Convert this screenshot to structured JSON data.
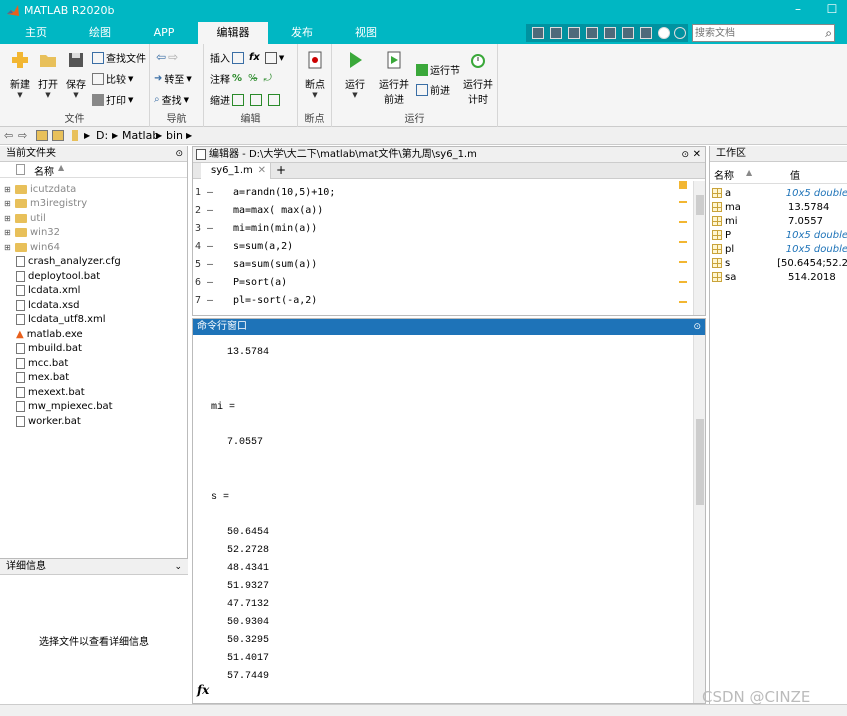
{
  "window": {
    "title": "MATLAB R2020b"
  },
  "tabs": [
    "主页",
    "绘图",
    "APP",
    "编辑器",
    "发布",
    "视图"
  ],
  "active_tab": "编辑器",
  "search": {
    "placeholder": "搜索文档"
  },
  "ribbon": {
    "file": {
      "new": "新建",
      "open": "打开",
      "save": "保存",
      "find_files": "查找文件",
      "compare": "比较",
      "print": "打印",
      "group": "文件"
    },
    "navigate": {
      "goto": "转至",
      "find": "查找",
      "group": "导航"
    },
    "edit": {
      "insert": "插入",
      "comment": "注释",
      "indent": "缩进",
      "group": "编辑"
    },
    "breakpoints": {
      "label": "断点",
      "group": "断点"
    },
    "run": {
      "run": "运行",
      "run_advance": "运行并",
      "run_advance2": "前进",
      "run_section": "运行节",
      "advance": "前进",
      "run_time": "运行并",
      "run_time2": "计时",
      "group": "运行"
    }
  },
  "address": {
    "drive": "D:",
    "folder1": "Matlab",
    "folder2": "bin"
  },
  "current_folder": {
    "title": "当前文件夹",
    "col_name": "名称",
    "folders": [
      "icutzdata",
      "m3iregistry",
      "util",
      "win32",
      "win64"
    ],
    "files": [
      "crash_analyzer.cfg",
      "deploytool.bat",
      "lcdata.xml",
      "lcdata.xsd",
      "lcdata_utf8.xml",
      "matlab.exe",
      "mbuild.bat",
      "mcc.bat",
      "mex.bat",
      "mexext.bat",
      "mw_mpiexec.bat",
      "worker.bat"
    ]
  },
  "details": {
    "title": "详细信息",
    "message": "选择文件以查看详细信息"
  },
  "editor": {
    "title": "编辑器 - D:\\大学\\大二下\\matlab\\mat文件\\第九周\\sy6_1.m",
    "tab": "sy6_1.m",
    "lines": [
      {
        "n": "1",
        "code": "a=randn(10,5)+10;"
      },
      {
        "n": "2",
        "code": "ma=max( max(a))"
      },
      {
        "n": "3",
        "code": "mi=min(min(a))"
      },
      {
        "n": "4",
        "code": "s=sum(a,2)"
      },
      {
        "n": "5",
        "code": "sa=sum(sum(a))"
      },
      {
        "n": "6",
        "code": "P=sort(a)"
      },
      {
        "n": "7",
        "code": "pl=-sort(-a,2)"
      }
    ]
  },
  "command": {
    "title": "命令行窗口",
    "lines": [
      {
        "t": "13.5784",
        "indent": 1
      },
      {
        "t": "mi =",
        "indent": 0
      },
      {
        "t": "7.0557",
        "indent": 1
      },
      {
        "t": "s =",
        "indent": 0
      },
      {
        "t": "50.6454",
        "indent": 1
      },
      {
        "t": "52.2728",
        "indent": 1
      },
      {
        "t": "48.4341",
        "indent": 1
      },
      {
        "t": "51.9327",
        "indent": 1
      },
      {
        "t": "47.7132",
        "indent": 1
      },
      {
        "t": "50.9304",
        "indent": 1
      },
      {
        "t": "50.3295",
        "indent": 1
      },
      {
        "t": "51.4017",
        "indent": 1
      },
      {
        "t": "57.7449",
        "indent": 1
      }
    ],
    "prompt_icon": "fx"
  },
  "workspace": {
    "title": "工作区",
    "col_name": "名称",
    "col_value": "值",
    "vars": [
      {
        "name": "a",
        "value": "10x5 double",
        "italic": true
      },
      {
        "name": "ma",
        "value": "13.5784",
        "italic": false
      },
      {
        "name": "mi",
        "value": "7.0557",
        "italic": false
      },
      {
        "name": "P",
        "value": "10x5 double",
        "italic": true
      },
      {
        "name": "pl",
        "value": "10x5 double",
        "italic": true
      },
      {
        "name": "s",
        "value": "[50.6454;52.2",
        "italic": false
      },
      {
        "name": "sa",
        "value": "514.2018",
        "italic": false
      }
    ]
  },
  "watermark": "CSDN @CINZE"
}
